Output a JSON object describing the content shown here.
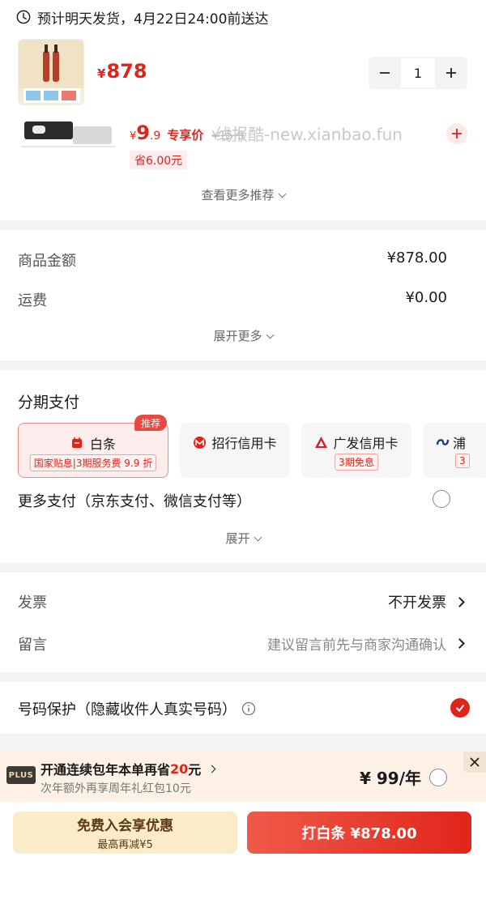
{
  "delivery": {
    "text": "预计明天发货，4月22日24:00前送达"
  },
  "product": {
    "currency": "¥",
    "price": "878",
    "quantity": "1"
  },
  "recommend": {
    "currency": "¥",
    "price_int": "9",
    "price_dec": ".9",
    "tag": "专享价",
    "original_price": "¥15.9",
    "save": "省6.00元",
    "watermark": "线报酷-new.xianbao.fun",
    "more": "查看更多推荐"
  },
  "amounts": {
    "goods_label": "商品金额",
    "goods_value": "¥878.00",
    "shipping_label": "运费",
    "shipping_value": "¥0.00",
    "expand": "展开更多"
  },
  "installment": {
    "title": "分期支付",
    "recommend_flag": "推荐",
    "cards": [
      {
        "name": "白条",
        "sub": "国家贴息|3期服务费 9.9 折"
      },
      {
        "name": "招行信用卡",
        "sub": ""
      },
      {
        "name": "广发信用卡",
        "sub": "3期免息"
      },
      {
        "name": "浦",
        "sub": "3"
      }
    ],
    "more_pay": "更多支付（京东支付、微信支付等）",
    "expand": "展开"
  },
  "invoice": {
    "label": "发票",
    "value": "不开发票"
  },
  "message": {
    "label": "留言",
    "placeholder": "建议留言前先与商家沟通确认"
  },
  "privacy": {
    "label": "号码保护（隐藏收件人真实号码）"
  },
  "plus": {
    "badge": "PLUS",
    "title_pre": "开通连续包年本单再省",
    "title_amount": "20",
    "title_post": "元",
    "sub": "次年额外再享周年礼红包10元",
    "price": "¥ 99/年"
  },
  "buttons": {
    "member_l1": "免费入会享优惠",
    "member_l2": "最高再减¥5",
    "pay": "打白条 ¥878.00"
  },
  "colors": {
    "accent": "#e2231a",
    "gap": "#f3f3f3",
    "plus_bg": "#fdf1e5",
    "member_btn": "#fcebc9"
  }
}
